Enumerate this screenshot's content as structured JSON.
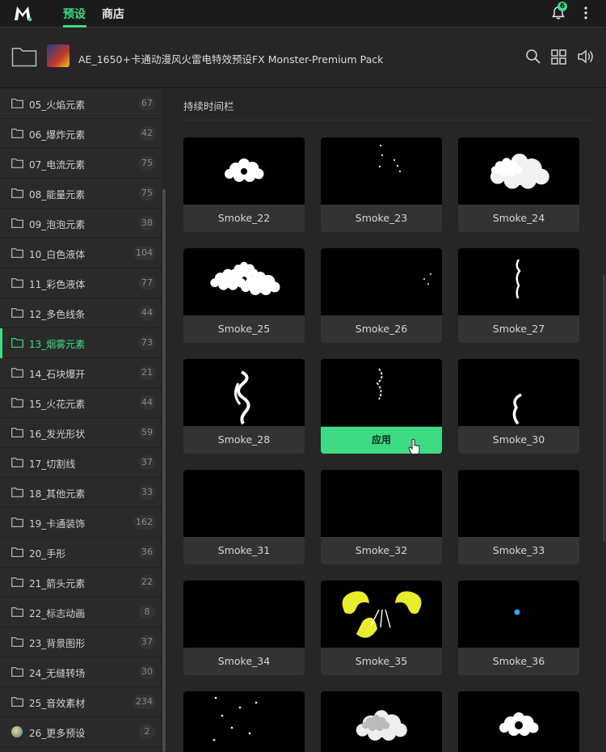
{
  "topbar": {
    "tabs": [
      {
        "label": "预设",
        "active": true
      },
      {
        "label": "商店",
        "active": false
      }
    ],
    "notification_count": "6",
    "accent_color": "#3ddc84"
  },
  "pack": {
    "title": "AE_1650+卡通动漫风火雷电特效预设FX Monster-Premium Pack"
  },
  "sidebar": {
    "items": [
      {
        "label": "05_火焰元素",
        "count": "67"
      },
      {
        "label": "06_爆炸元素",
        "count": "42"
      },
      {
        "label": "07_电流元素",
        "count": "75"
      },
      {
        "label": "08_能量元素",
        "count": "75"
      },
      {
        "label": "09_泡泡元素",
        "count": "38"
      },
      {
        "label": "10_白色液体",
        "count": "104"
      },
      {
        "label": "11_彩色液体",
        "count": "77"
      },
      {
        "label": "12_多色线条",
        "count": "44"
      },
      {
        "label": "13_烟雾元素",
        "count": "73",
        "active": true
      },
      {
        "label": "14_石块爆开",
        "count": "21"
      },
      {
        "label": "15_火花元素",
        "count": "44"
      },
      {
        "label": "16_发光形状",
        "count": "59"
      },
      {
        "label": "17_切割线",
        "count": "37"
      },
      {
        "label": "18_其他元素",
        "count": "33"
      },
      {
        "label": "19_卡通装饰",
        "count": "162"
      },
      {
        "label": "20_手形",
        "count": "36"
      },
      {
        "label": "21_箭头元素",
        "count": "22"
      },
      {
        "label": "22_标志动画",
        "count": "8"
      },
      {
        "label": "23_背景图形",
        "count": "37"
      },
      {
        "label": "24_无缝转场",
        "count": "30"
      },
      {
        "label": "25_音效素材",
        "count": "234"
      },
      {
        "label": "26_更多预设",
        "count": "2"
      }
    ]
  },
  "main": {
    "section_title": "持续时间栏",
    "apply_label": "应用",
    "cards": [
      {
        "label": "Smoke_22"
      },
      {
        "label": "Smoke_23"
      },
      {
        "label": "Smoke_24"
      },
      {
        "label": "Smoke_25"
      },
      {
        "label": "Smoke_26"
      },
      {
        "label": "Smoke_27"
      },
      {
        "label": "Smoke_28"
      },
      {
        "label": "",
        "hovered": true
      },
      {
        "label": "Smoke_30"
      },
      {
        "label": "Smoke_31"
      },
      {
        "label": "Smoke_32"
      },
      {
        "label": "Smoke_33"
      },
      {
        "label": "Smoke_34"
      },
      {
        "label": "Smoke_35"
      },
      {
        "label": "Smoke_36"
      },
      {
        "label": ""
      },
      {
        "label": ""
      },
      {
        "label": ""
      }
    ]
  }
}
